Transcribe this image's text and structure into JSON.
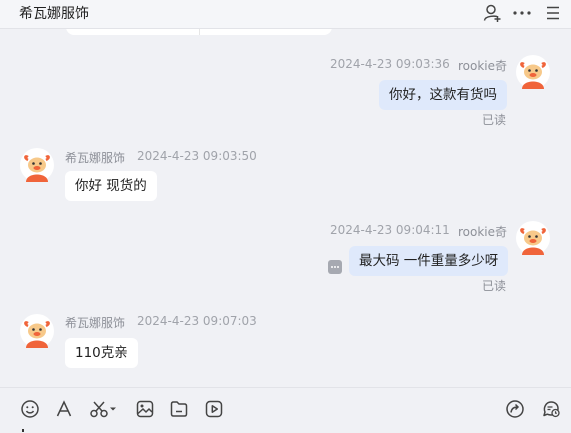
{
  "header": {
    "title": "希瓦娜服饰",
    "icons": [
      "add-user-icon",
      "more-dots-icon",
      "menu-icon"
    ]
  },
  "messages": [
    {
      "direction": "out",
      "sender": "rookie奇",
      "time": "2024-4-23 09:03:36",
      "text": "你好，这款有货吗",
      "status": "已读"
    },
    {
      "direction": "in",
      "sender": "希瓦娜服饰",
      "time": "2024-4-23 09:03:50",
      "text": "你好 现货的"
    },
    {
      "direction": "out",
      "sender": "rookie奇",
      "time": "2024-4-23 09:04:11",
      "text": "最大码 一件重量多少呀",
      "status": "已读"
    },
    {
      "direction": "in",
      "sender": "希瓦娜服饰",
      "time": "2024-4-23 09:07:03",
      "text": "110克亲"
    }
  ],
  "toolbar": {
    "icons": [
      "emoji-icon",
      "font-icon",
      "scissors-icon",
      "image-icon",
      "folder-icon",
      "video-icon",
      "share-icon",
      "chat-history-icon"
    ]
  },
  "colors": {
    "background": "#f0f1f5",
    "outgoing_bubble": "#dfe9fb",
    "incoming_bubble": "#ffffff",
    "avatar_orange": "#f0643a"
  }
}
